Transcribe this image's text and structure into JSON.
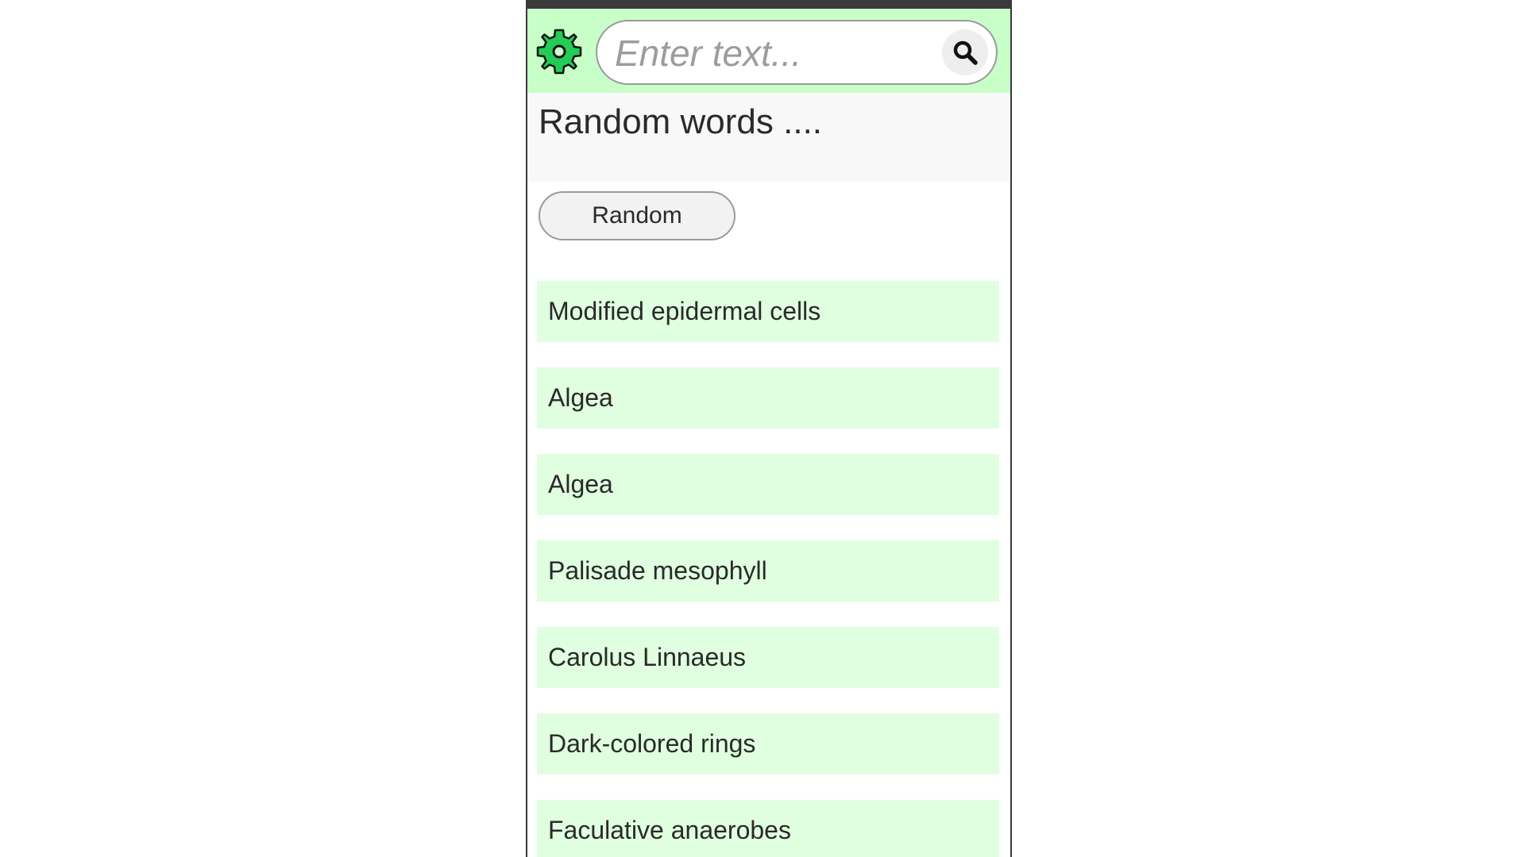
{
  "search": {
    "placeholder": "Enter text...",
    "value": ""
  },
  "icons": {
    "settings": "gear-icon",
    "search": "search-icon"
  },
  "colors": {
    "header_bg": "#c8ffc8",
    "item_bg": "#e0ffe0",
    "gear_fill": "#22cc55"
  },
  "page": {
    "title": "Random words ...."
  },
  "random_button": {
    "label": "Random"
  },
  "words": [
    "Modified epidermal cells",
    "Algea",
    "Algea",
    "Palisade mesophyll",
    "Carolus Linnaeus",
    "Dark-colored rings",
    "Faculative anaerobes"
  ]
}
